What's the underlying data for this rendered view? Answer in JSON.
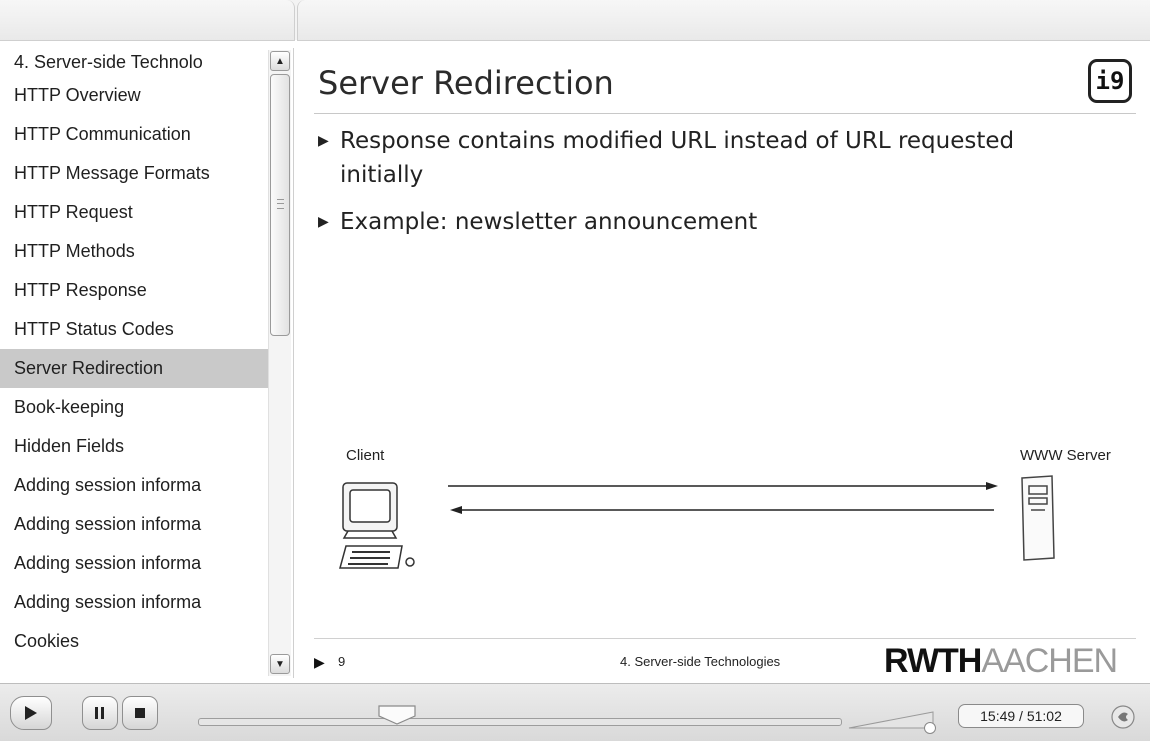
{
  "sidebar": {
    "items": [
      {
        "label": "4. Server-side Technolo"
      },
      {
        "label": "HTTP Overview"
      },
      {
        "label": "HTTP Communication"
      },
      {
        "label": "HTTP Message Formats"
      },
      {
        "label": "HTTP Request"
      },
      {
        "label": "HTTP Methods"
      },
      {
        "label": "HTTP Response"
      },
      {
        "label": "HTTP Status Codes"
      },
      {
        "label": "Server Redirection"
      },
      {
        "label": "Book-keeping"
      },
      {
        "label": "Hidden Fields"
      },
      {
        "label": "Adding session informa"
      },
      {
        "label": "Adding session informa"
      },
      {
        "label": "Adding session informa"
      },
      {
        "label": "Adding session informa"
      },
      {
        "label": "Cookies"
      }
    ],
    "active_label": "Server Redirection"
  },
  "slide": {
    "title": "Server Redirection",
    "logo_text": "i9",
    "bullets": [
      {
        "line1": "Response contains modified URL instead of URL requested",
        "line2": "initially"
      },
      {
        "line1": "Example: newsletter announcement",
        "line2": ""
      }
    ],
    "diagram": {
      "client_label": "Client",
      "server_label": "WWW Server"
    },
    "footer": {
      "page_number": "9",
      "chapter": "4. Server-side Technologies",
      "brand_bold": "RWTH",
      "brand_light": "AACHEN"
    }
  },
  "player": {
    "time": "15:49 / 51:02",
    "progress_fraction": 0.31,
    "volume_fraction": 0.95,
    "icons": [
      "play-icon",
      "pause-icon",
      "stop-icon",
      "speaker-icon"
    ]
  },
  "colors": {
    "active_item_bg": "#c9c9c9",
    "brand_light": "#9a9a9a"
  }
}
